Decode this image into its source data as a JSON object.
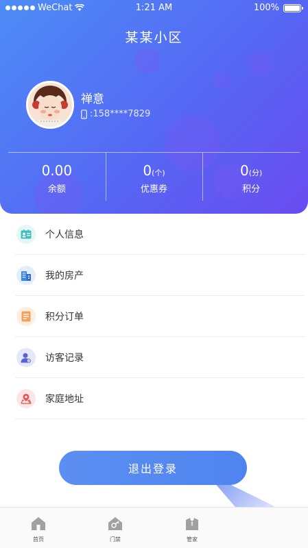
{
  "status_bar": {
    "carrier": "WeChat",
    "time": "1:21 AM",
    "battery": "100%"
  },
  "header": {
    "title": "某某小区"
  },
  "user": {
    "name": "禅意",
    "phone": ":158****7829"
  },
  "stats": [
    {
      "value": "0.00",
      "unit": "",
      "label": "余额"
    },
    {
      "value": "0",
      "unit": "(个)",
      "label": "优惠券"
    },
    {
      "value": "0",
      "unit": "(分)",
      "label": "积分"
    }
  ],
  "menu": [
    {
      "label": "个人信息",
      "icon": "id-card-icon",
      "color": "#3bbfc0"
    },
    {
      "label": "我的房产",
      "icon": "building-icon",
      "color": "#3d85e8"
    },
    {
      "label": "积分订单",
      "icon": "order-list-icon",
      "color": "#f2a25a"
    },
    {
      "label": "访客记录",
      "icon": "visitor-icon",
      "color": "#5663d8"
    },
    {
      "label": "家庭地址",
      "icon": "map-pin-icon",
      "color": "#e05a5a"
    }
  ],
  "logout": {
    "label": "退出登录"
  },
  "tabs": [
    {
      "label": "首页",
      "icon": "home-icon"
    },
    {
      "label": "门禁",
      "icon": "key-house-icon"
    },
    {
      "label": "管家",
      "icon": "butler-icon"
    },
    {
      "label": "",
      "icon": ""
    }
  ],
  "colors": {
    "gradient_start": "#4d8cf6",
    "gradient_end": "#6a4bf0",
    "button": "#5d8ff2"
  }
}
